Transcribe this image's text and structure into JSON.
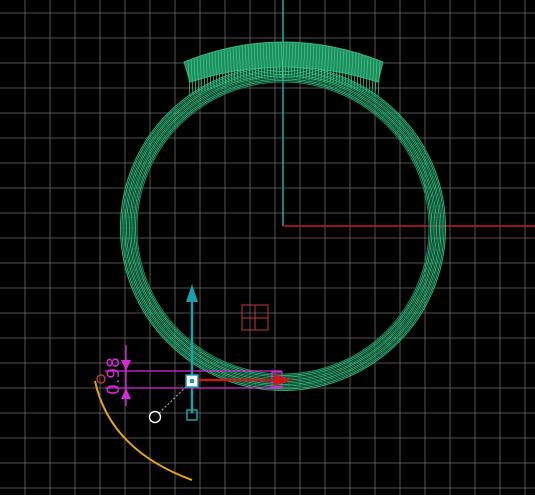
{
  "viewport": {
    "background": "#000000",
    "grid_color": "#6b6b6b",
    "grid_visible": true
  },
  "axes": {
    "x_axis_color": "#cc1a1a",
    "y_axis_color": "#1a9fae"
  },
  "ring": {
    "wire_color": "#2fb37a",
    "wire_color_dark": "#1f8a5c"
  },
  "dimension": {
    "value": "0.98",
    "color": "#d62ad6"
  },
  "gizmo": {
    "up_arrow_color": "#1a9fae",
    "right_arrow_color": "#cc1a1a",
    "profile_arc_color": "#e6a317",
    "pivot_icon": "square-pivot-icon",
    "node_icon": "circle-node-icon"
  }
}
